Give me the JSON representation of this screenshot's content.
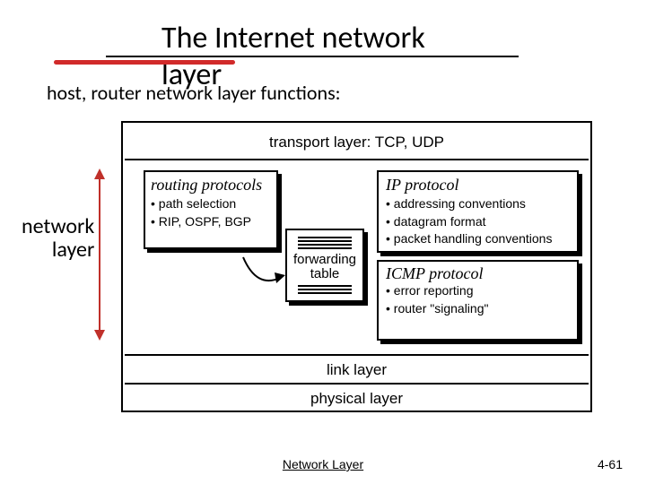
{
  "title": "The Internet network layer",
  "subtitle": "host, router network layer functions:",
  "label_network_layer": "network\nlayer",
  "layers": {
    "transport": "transport layer: TCP, UDP",
    "link": "link layer",
    "physical": "physical layer"
  },
  "routing": {
    "title": "routing protocols",
    "bullet1": "• path selection",
    "bullet2": "• RIP, OSPF, BGP"
  },
  "forwarding_table": "forwarding\ntable",
  "ip": {
    "title": "IP protocol",
    "bullet1": "• addressing conventions",
    "bullet2": "• datagram format",
    "bullet3": "• packet handling conventions"
  },
  "icmp": {
    "title": "ICMP protocol",
    "bullet1": "• error reporting",
    "bullet2": "• router \"signaling\""
  },
  "footer": {
    "center": "Network Layer",
    "right": "4-61"
  }
}
